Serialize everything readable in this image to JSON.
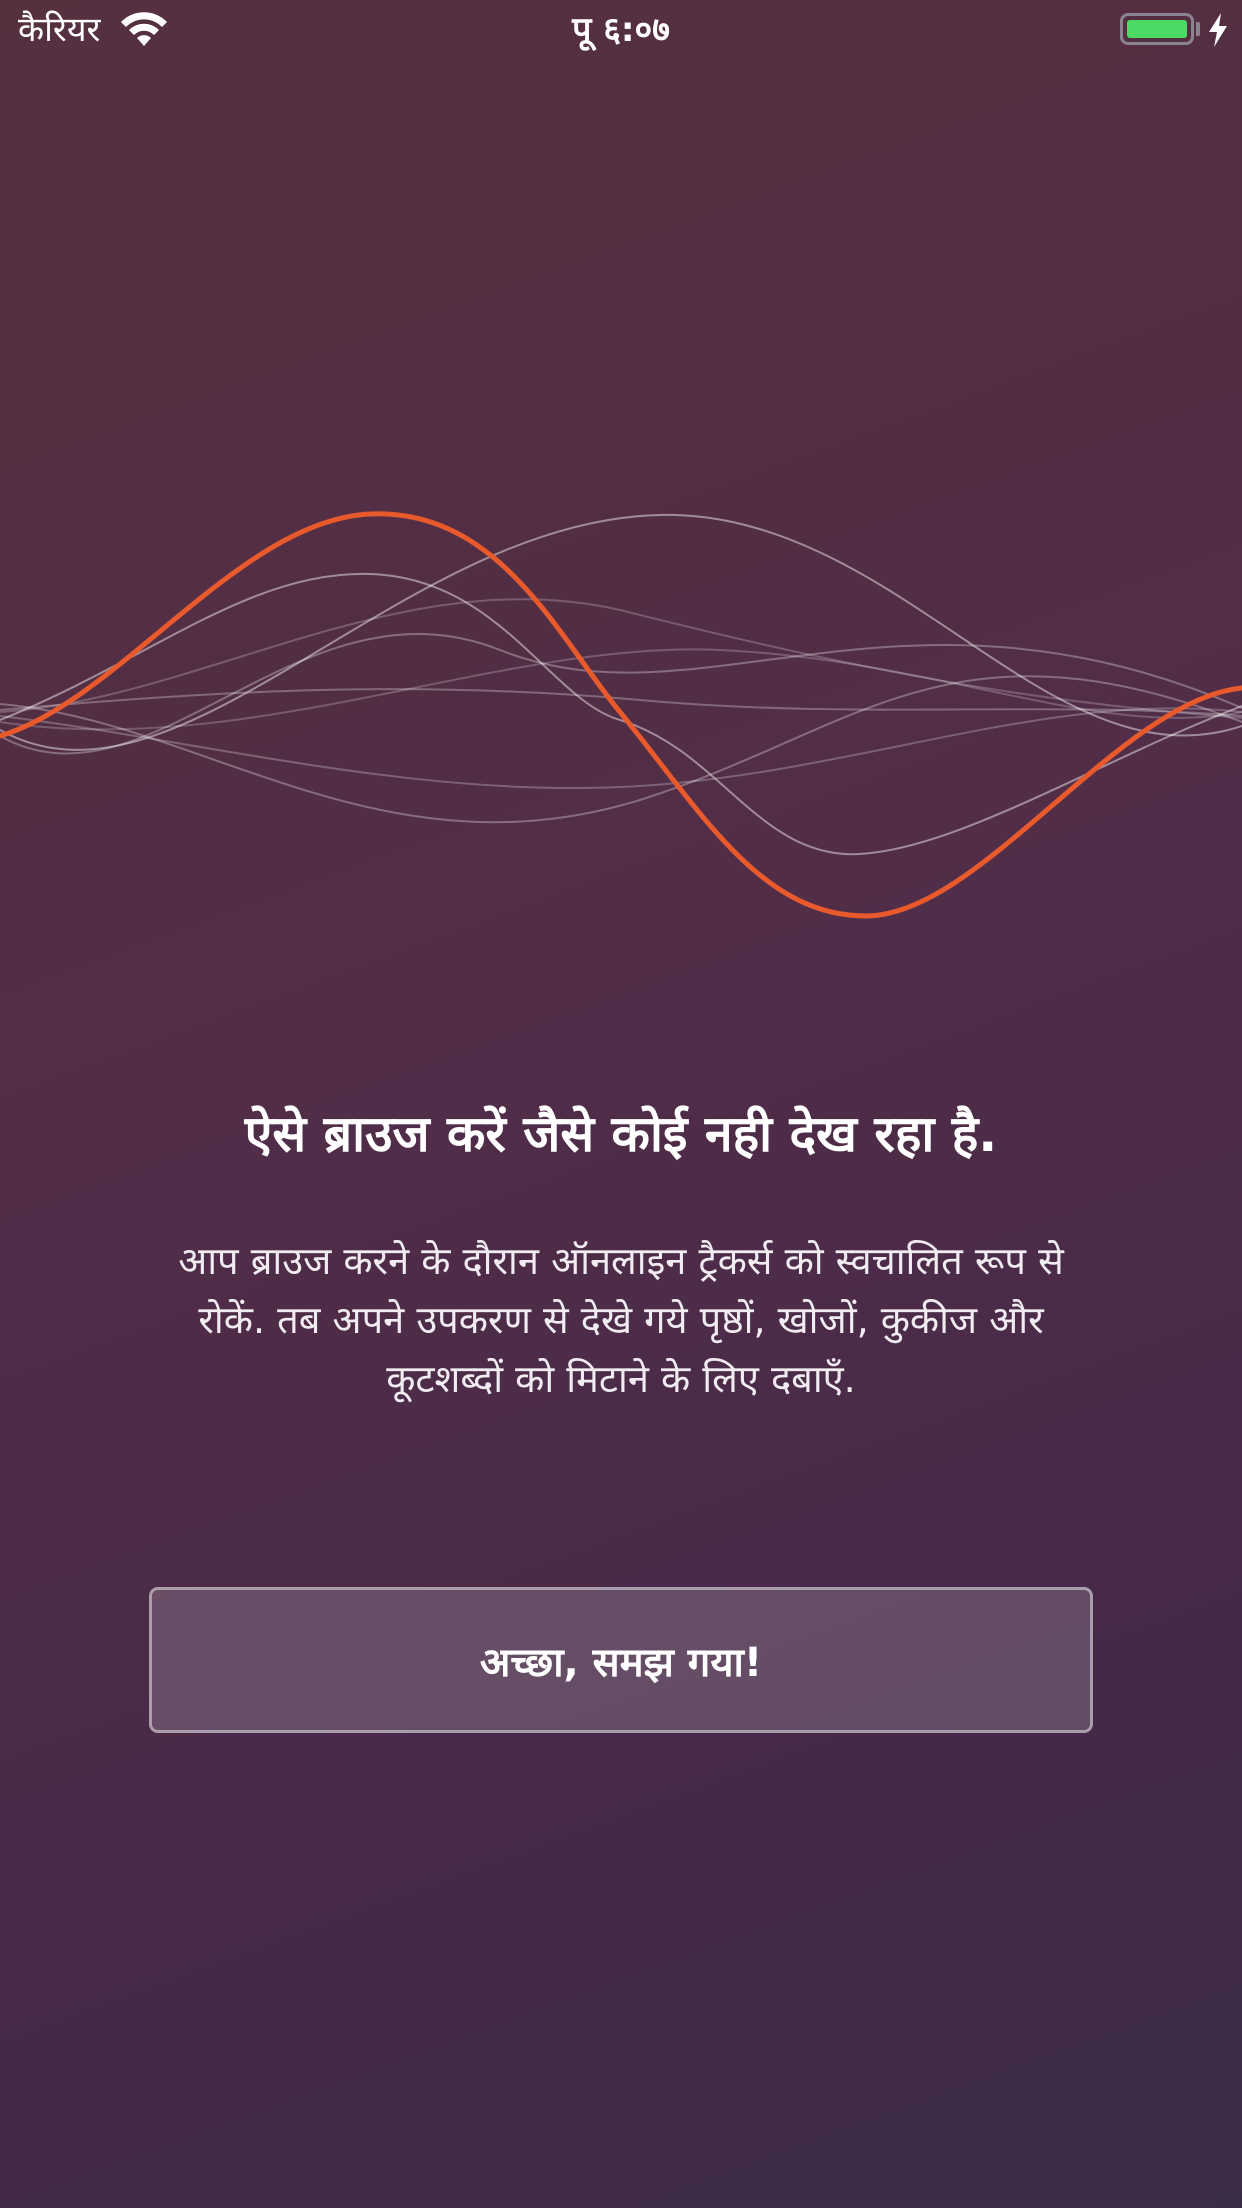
{
  "status_bar": {
    "carrier": "कैरियर",
    "time": "पू ६:०७",
    "battery_level": 1.0
  },
  "onboarding": {
    "headline": "ऐसे ब्राउज करें जैसे कोई नही देख रहा है.",
    "body": "आप ब्राउज करने के दौरान ऑनलाइन ट्रैकर्स को स्वचालित रूप से रोकें. तब अपने उपकरण से देखे गये पृष्ठों, खोजों, कुकीज और कूटशब्दों को मिटाने के लिए दबाएँ.",
    "button_label": "अच्छा, समझ गया!"
  },
  "colors": {
    "accent_wave": "#e85a2c",
    "battery_fill": "#4cd964",
    "background_start": "#55303f",
    "background_end": "#3b2c45"
  },
  "icons": [
    "wifi-icon",
    "battery-icon",
    "charging-bolt-icon",
    "sound-wave-illustration"
  ]
}
